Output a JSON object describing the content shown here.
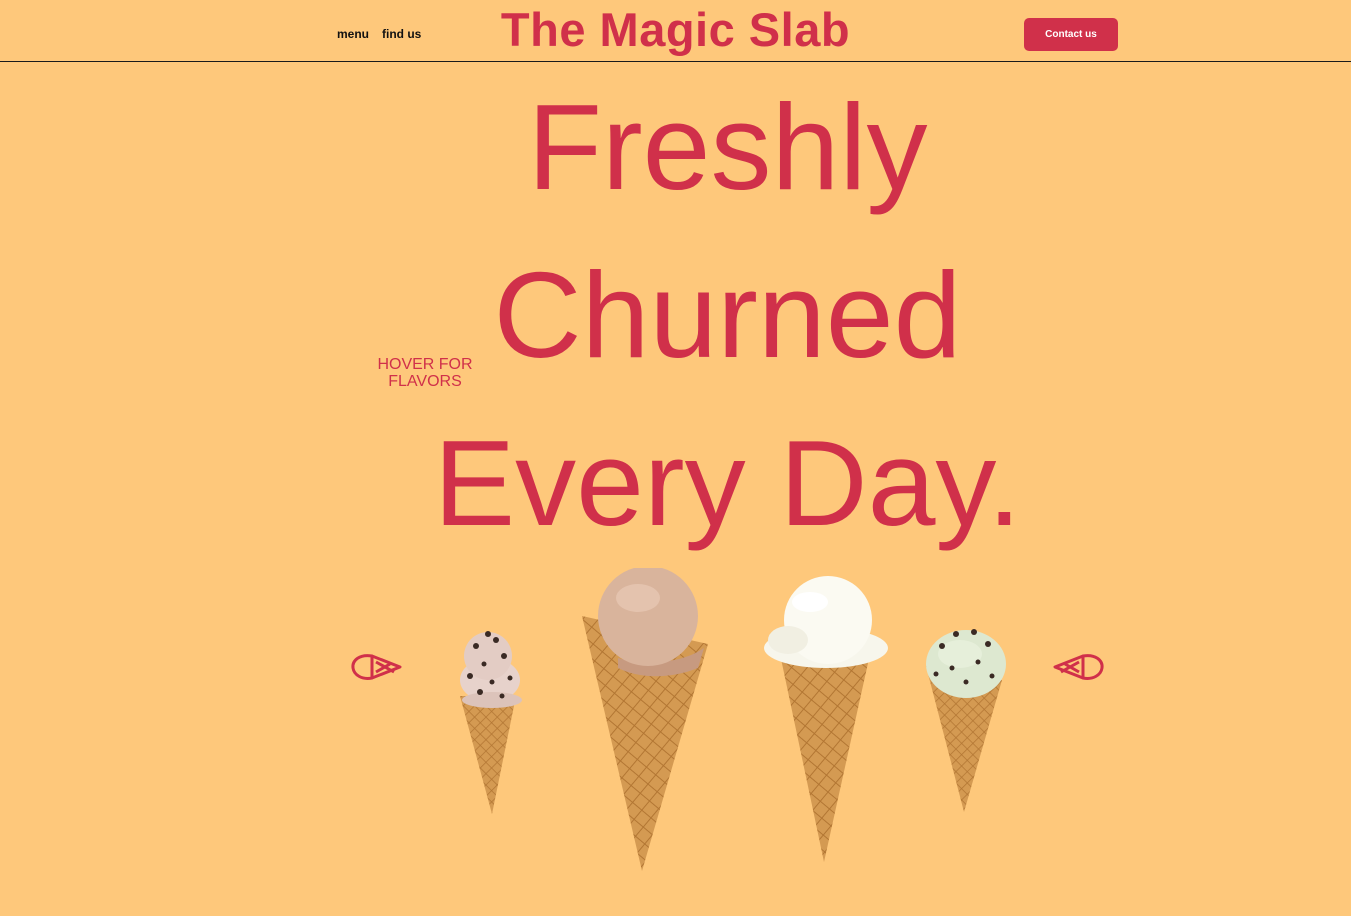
{
  "header": {
    "nav": [
      {
        "label": "menu"
      },
      {
        "label": "find us"
      }
    ],
    "brand": "The Magic Slab",
    "contact_label": "Contact us"
  },
  "hero": {
    "lines": [
      "Freshly",
      "Churned",
      "Every Day."
    ],
    "hover_hint": "HOVER FOR FLAVORS"
  },
  "colors": {
    "background": "#FEC87B",
    "accent": "#D0304A"
  },
  "carousel": {
    "prev_icon": "ice-cream-cone-left-icon",
    "next_icon": "ice-cream-cone-right-icon",
    "items": [
      {
        "flavor_icon": "cookies-and-cream-cone"
      },
      {
        "flavor_icon": "coffee-cone"
      },
      {
        "flavor_icon": "vanilla-cone"
      },
      {
        "flavor_icon": "mint-chocolate-chip-cone"
      }
    ]
  }
}
